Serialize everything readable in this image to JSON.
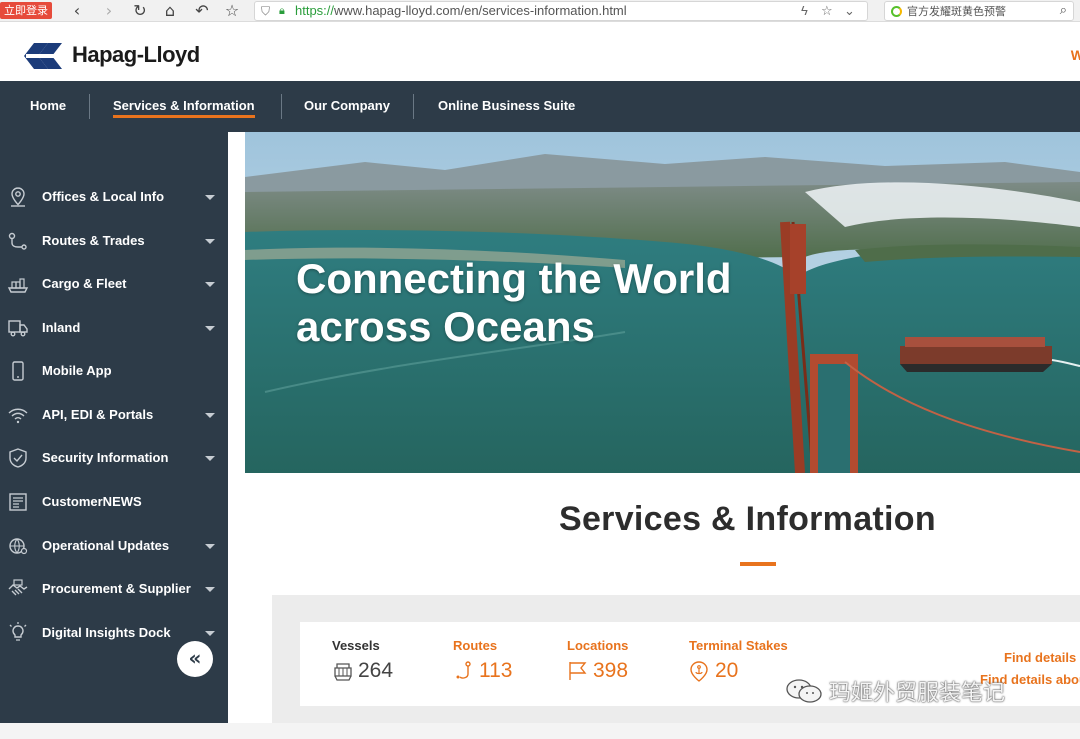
{
  "browser": {
    "login_badge": "立即登录",
    "url_scheme": "https://",
    "url_rest": "www.hapag-lloyd.com/en/services-information.html",
    "search_hint": "官方发耀斑黄色预警"
  },
  "header": {
    "logo_text": "Hapag-Lloyd",
    "right_text": "W"
  },
  "main_nav": [
    {
      "label": "Home",
      "active": false
    },
    {
      "label": "Services & Information",
      "active": true
    },
    {
      "label": "Our Company",
      "active": false
    },
    {
      "label": "Online Business Suite",
      "active": false
    }
  ],
  "sidebar": {
    "items": [
      {
        "label": "Offices & Local Info",
        "icon": "location-pin-icon",
        "has_caret": true
      },
      {
        "label": "Routes & Trades",
        "icon": "route-icon",
        "has_caret": true
      },
      {
        "label": "Cargo & Fleet",
        "icon": "ship-icon",
        "has_caret": true
      },
      {
        "label": "Inland",
        "icon": "truck-icon",
        "has_caret": true
      },
      {
        "label": "Mobile App",
        "icon": "phone-icon",
        "has_caret": false
      },
      {
        "label": "API, EDI & Portals",
        "icon": "wifi-icon",
        "has_caret": true
      },
      {
        "label": "Security Information",
        "icon": "shield-icon",
        "has_caret": true
      },
      {
        "label": "CustomerNEWS",
        "icon": "newspaper-icon",
        "has_caret": false
      },
      {
        "label": "Operational Updates",
        "icon": "globe-gear-icon",
        "has_caret": true
      },
      {
        "label": "Procurement & Supplier",
        "icon": "handshake-icon",
        "has_caret": true
      },
      {
        "label": "Digital Insights Dock",
        "icon": "lightbulb-icon",
        "has_caret": true
      }
    ],
    "collapse_label": "«"
  },
  "hero": {
    "title_line1": "Connecting the World",
    "title_line2": "across Oceans"
  },
  "section": {
    "title": "Services & Information"
  },
  "stats": [
    {
      "label": "Vessels",
      "value": "264",
      "icon": "vessel-icon",
      "style": "dark"
    },
    {
      "label": "Routes",
      "value": "113",
      "icon": "route-hook-icon",
      "style": "orange"
    },
    {
      "label": "Locations",
      "value": "398",
      "icon": "flag-icon",
      "style": "orange"
    },
    {
      "label": "Terminal Stakes",
      "value": "20",
      "icon": "anchor-icon",
      "style": "orange"
    }
  ],
  "find_links": {
    "line1": "Find details",
    "line2": "Find details abou"
  },
  "watermark": {
    "text": "玛姬外贸服装笔记"
  },
  "colors": {
    "nav_bg": "#2d3b48",
    "accent": "#e8731d"
  }
}
